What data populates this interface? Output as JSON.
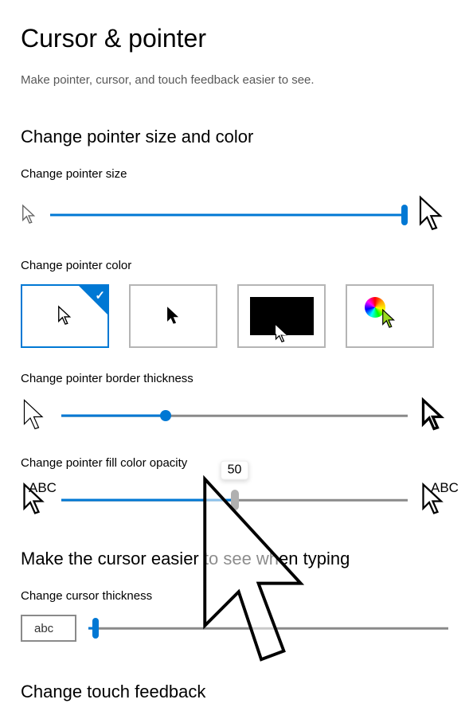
{
  "page": {
    "title": "Cursor & pointer",
    "subtitle": "Make pointer, cursor, and touch feedback easier to see."
  },
  "sections": {
    "size_color_heading": "Change pointer size and color",
    "size_label": "Change pointer size",
    "color_label": "Change pointer color",
    "border_label": "Change pointer border thickness",
    "opacity_label": "Change pointer fill color opacity",
    "cursor_heading": "Make the cursor easier to see when typing",
    "thickness_label": "Change cursor thickness",
    "touch_heading": "Change touch feedback"
  },
  "sliders": {
    "pointer_size": {
      "min": 1,
      "max": 15,
      "value": 15,
      "percent": 100
    },
    "border_thickness": {
      "min": 0,
      "max": 100,
      "value": 30,
      "percent": 30
    },
    "fill_opacity": {
      "min": 0,
      "max": 100,
      "value": 50,
      "percent": 50,
      "tooltip": "50"
    },
    "cursor_thickness": {
      "min": 1,
      "max": 20,
      "value": 1,
      "percent": 2
    }
  },
  "color_options": {
    "selected_index": 0,
    "items": [
      {
        "name": "white",
        "selected": true
      },
      {
        "name": "black",
        "selected": false
      },
      {
        "name": "inverted",
        "selected": false
      },
      {
        "name": "custom",
        "selected": false
      }
    ]
  },
  "samples": {
    "abc_left": "ABC",
    "abc_right": "ABC",
    "thickness_sample": "abc"
  },
  "chart_data": {
    "type": "table",
    "title": "Pointer and cursor settings",
    "rows": [
      {
        "setting": "Pointer size",
        "value": 15,
        "range": [
          1,
          15
        ]
      },
      {
        "setting": "Pointer border thickness",
        "value": 30,
        "range": [
          0,
          100
        ]
      },
      {
        "setting": "Pointer fill color opacity",
        "value": 50,
        "range": [
          0,
          100
        ]
      },
      {
        "setting": "Cursor thickness",
        "value": 1,
        "range": [
          1,
          20
        ]
      },
      {
        "setting": "Pointer color option",
        "value": "white"
      }
    ]
  }
}
